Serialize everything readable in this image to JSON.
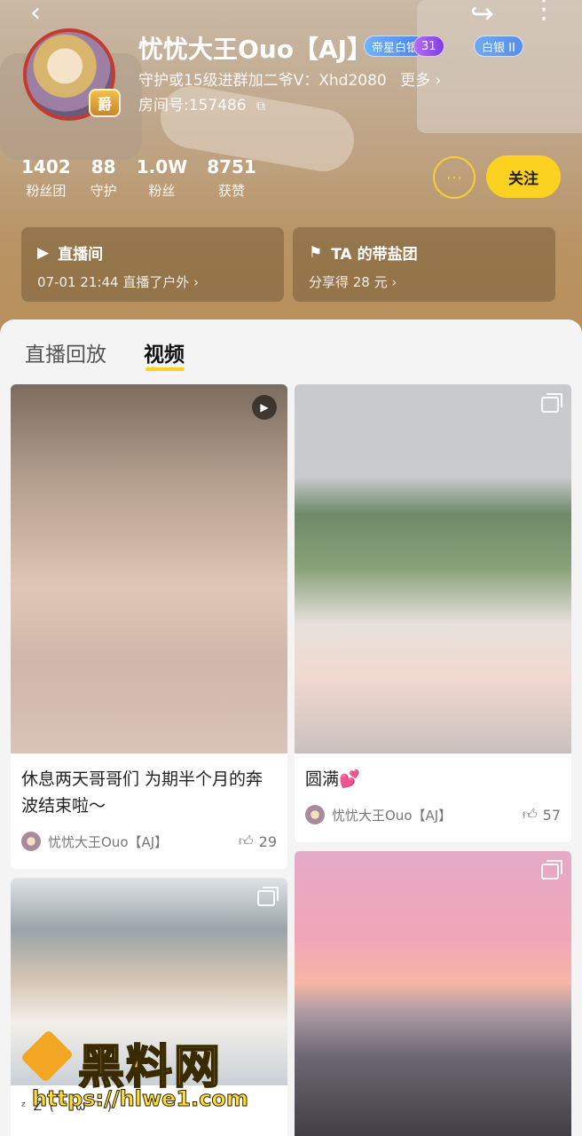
{
  "profile": {
    "name": "忧忧大王Ouo【AJ】",
    "badges": [
      "帝星白银",
      "31",
      "白银 II"
    ],
    "intro": "守护或15级进群加二爷V：Xhd2080",
    "intro_more": "更多 ›",
    "room_no": "房间号:157486",
    "avatar_badge": "爵"
  },
  "stats": [
    {
      "value": "1402",
      "label": "粉丝团"
    },
    {
      "value": "88",
      "label": "守护"
    },
    {
      "value": "1.0W",
      "label": "粉丝"
    },
    {
      "value": "8751",
      "label": "获赞"
    }
  ],
  "actions": {
    "follow": "关注",
    "message_icon": "chat-icon"
  },
  "cards": {
    "live": {
      "title": "直播间",
      "sub": "07-01 21:44 直播了户外 ›"
    },
    "group": {
      "title": "TA 的带盐团",
      "sub": "分享得 28 元 ›"
    }
  },
  "tabs": {
    "replay": "直播回放",
    "video": "视频"
  },
  "videos": [
    {
      "title": "休息两天哥哥们 为期半个月的奔波结束啦～",
      "author": "忧忧大王Ouo【AJ】",
      "likes": "29",
      "type": "video"
    },
    {
      "title": "圆满💕",
      "author": "忧忧大王Ouo【AJ】",
      "likes": "57",
      "type": "album"
    },
    {
      "caption": "ᶻ Z ( ˉ ω ˉ )",
      "type": "album"
    },
    {
      "type": "album"
    }
  ],
  "watermark": {
    "text": "黑料网",
    "url": "https://hlwe1.com"
  },
  "colors": {
    "accent": "#fbd21f",
    "header": "#b89262"
  }
}
